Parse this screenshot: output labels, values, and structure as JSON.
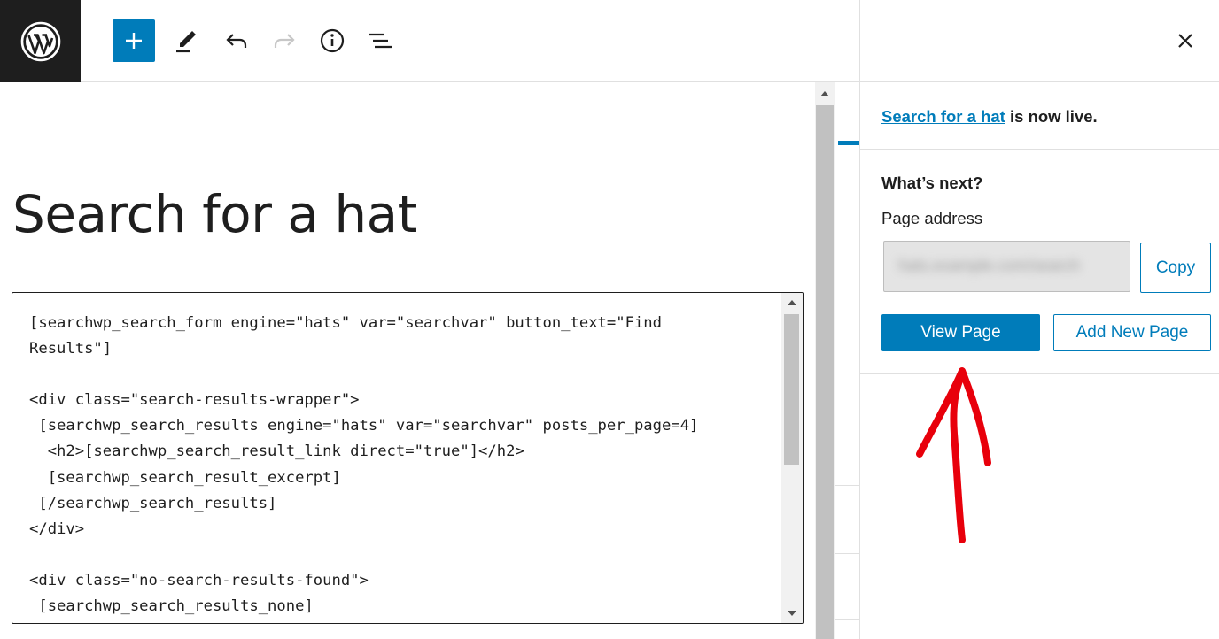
{
  "toolbar": {
    "logo_icon": "wordpress-logo",
    "add_icon": "plus-icon",
    "edit_icon": "pencil-icon",
    "undo_icon": "undo-icon",
    "redo_icon": "redo-icon",
    "info_icon": "info-icon",
    "list_view_icon": "list-view-icon",
    "accent_color": "#007cba"
  },
  "sidebar_header": {
    "close_icon": "close-icon"
  },
  "editor": {
    "post_title": "Search for a hat",
    "code_lines": [
      "[searchwp_search_form engine=\"hats\" var=\"searchvar\" button_text=\"Find",
      "Results\"]",
      "",
      "<div class=\"search-results-wrapper\">",
      " [searchwp_search_results engine=\"hats\" var=\"searchvar\" posts_per_page=4]",
      "  <h2>[searchwp_search_result_link direct=\"true\"]</h2>",
      "  [searchwp_search_result_excerpt]",
      " [/searchwp_search_results]",
      "</div>",
      "",
      "<div class=\"no-search-results-found\">",
      " [searchwp_search_results_none]"
    ]
  },
  "panel": {
    "live_link": "Search for a hat",
    "live_suffix": " is now live.",
    "whats_next": "What’s next?",
    "page_address_label": "Page address",
    "page_address_value": "hats.example.com/search",
    "copy_label": "Copy",
    "view_page_label": "View Page",
    "add_new_page_label": "Add New Page"
  },
  "annotation": {
    "arrow_color": "#e8000b"
  }
}
